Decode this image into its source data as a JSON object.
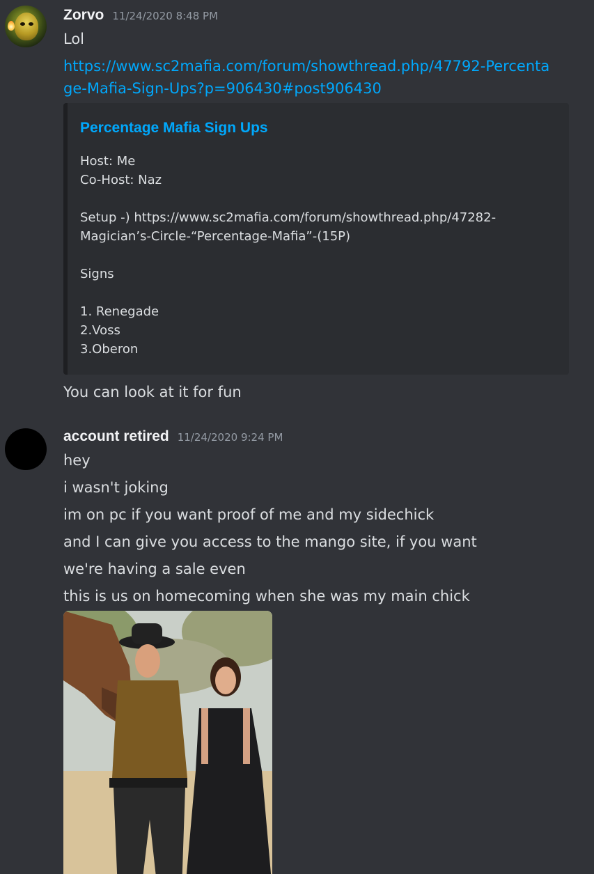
{
  "messages": [
    {
      "username": "Zorvo",
      "timestamp": "11/24/2020 8:48 PM",
      "lines": [
        "Lol"
      ],
      "link": "https://www.sc2mafia.com/forum/showthread.php/47792-Percentage-Mafia-Sign-Ups?p=906430#post906430",
      "embed": {
        "title": "Percentage Mafia Sign Ups",
        "description": [
          "Host: Me",
          "Co-Host: Naz",
          "",
          "Setup -) https://www.sc2mafia.com/forum/showthread.php/47282-",
          "Magician’s-Circle-“Percentage-Mafia”-(15P)",
          "",
          "Signs",
          "",
          "1. Renegade",
          "2.Voss",
          "3.Oberon"
        ]
      },
      "after_embed": "You can look at it for fun"
    },
    {
      "username": "account retired",
      "timestamp": "11/24/2020 9:24 PM",
      "lines": [
        "hey",
        "i wasn't joking",
        "im on pc if you want proof of me and my sidechick",
        "and I can give you access to the mango site, if you want",
        "we're having a sale even",
        "this is us on homecoming when she was my main chick"
      ]
    }
  ],
  "colors": {
    "background": "#313338",
    "embed_background": "#2b2d31",
    "link": "#00a8fc",
    "username": "#f2f3f5",
    "timestamp": "#949ba4",
    "text": "#dbdee1"
  }
}
